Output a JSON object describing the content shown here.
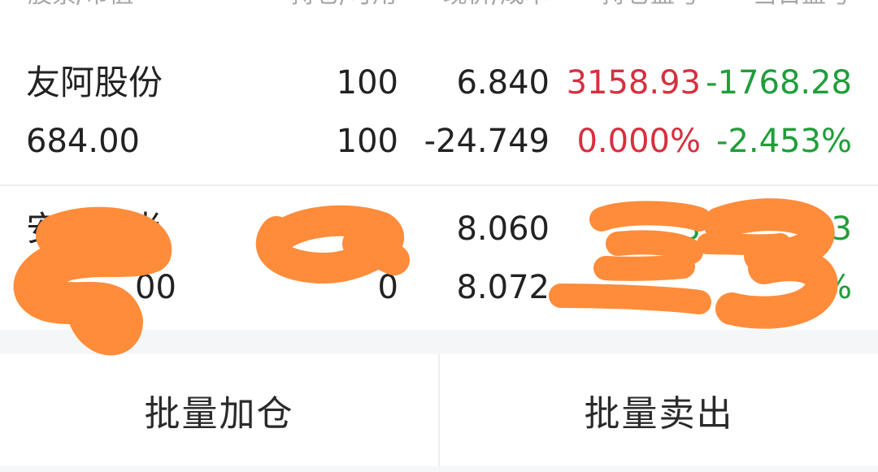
{
  "header": {
    "col1": "股票/市值",
    "col2": "持仓/可用",
    "col3": "现价/成本",
    "col4": "持仓盈亏",
    "col5": "当日盈亏"
  },
  "positions": [
    {
      "name": "友阿股份",
      "market_value": "684.00",
      "holding": "100",
      "available": "100",
      "price": "6.840",
      "cost": "-24.749",
      "pnl": "3158.93",
      "pnl_pct": "0.000%",
      "day_pnl": "-1768.28",
      "day_pnl_pct": "-2.453%"
    },
    {
      "name": "安正时尚",
      "market_value": "00",
      "holding": "",
      "available": "0",
      "price": "8.060",
      "cost": "8.072",
      "pnl": "3",
      "pnl_pct": "",
      "day_pnl": "03",
      "day_pnl_pct": "%"
    }
  ],
  "actions": {
    "batch_add": "批量加仓",
    "batch_sell": "批量卖出"
  },
  "colors": {
    "gain": "#d6303f",
    "loss": "#1f9e3a",
    "scribble": "#ff8c3a"
  }
}
